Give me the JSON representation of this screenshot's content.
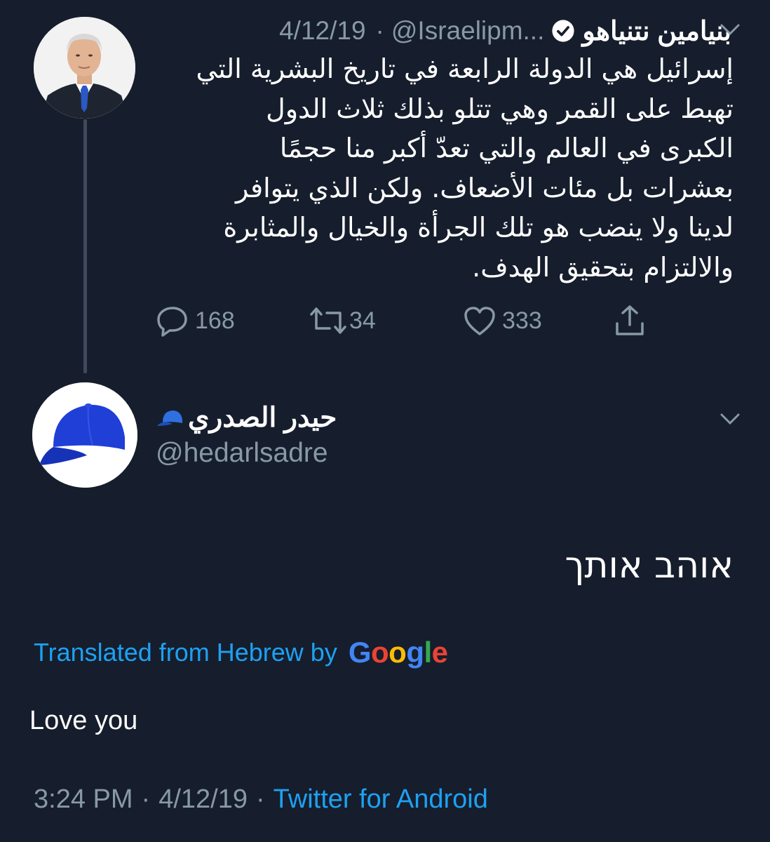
{
  "original_tweet": {
    "display_name": "بنيامين نتنياهو",
    "handle": "@Israelipm...",
    "separator": "·",
    "date": "4/12/19",
    "verified_icon": "verified-badge-icon",
    "body_lines": [
      "إسرائيل هي الدولة الرابعة في تاريخ البشرية التي",
      "تهبط على القمر وهي تتلو بذلك ثلاث الدول",
      "الكبرى في العالم والتي تعدّ أكبر منا حجمًا",
      "بعشرات بل مئات الأضعاف. ولكن الذي يتوافر",
      "لدينا ولا ينضب هو تلك الجرأة والخيال والمثابرة",
      "والالتزام بتحقيق الهدف."
    ],
    "actions": {
      "reply_count": "168",
      "retweet_count": "34",
      "like_count": "333"
    }
  },
  "reply_tweet": {
    "display_name": "حيدر الصدري",
    "name_emoji_icon": "blue-cap-icon",
    "handle": "@hedarlsadre",
    "body_hebrew": "אוהב אותך",
    "translated_label": "Translated from Hebrew by",
    "google_logo": [
      "G",
      "o",
      "o",
      "g",
      "l",
      "e"
    ],
    "translation": "Love you",
    "footer": {
      "time": "3:24 PM",
      "separator": "·",
      "date": "4/12/19",
      "app": "Twitter for Android"
    }
  },
  "colors": {
    "background": "#161d2c",
    "muted": "#8899a6",
    "link": "#1da1f2",
    "google_blue": "#4285f4",
    "google_red": "#ea4335",
    "google_yellow": "#fbbc05",
    "google_green": "#34a853"
  }
}
